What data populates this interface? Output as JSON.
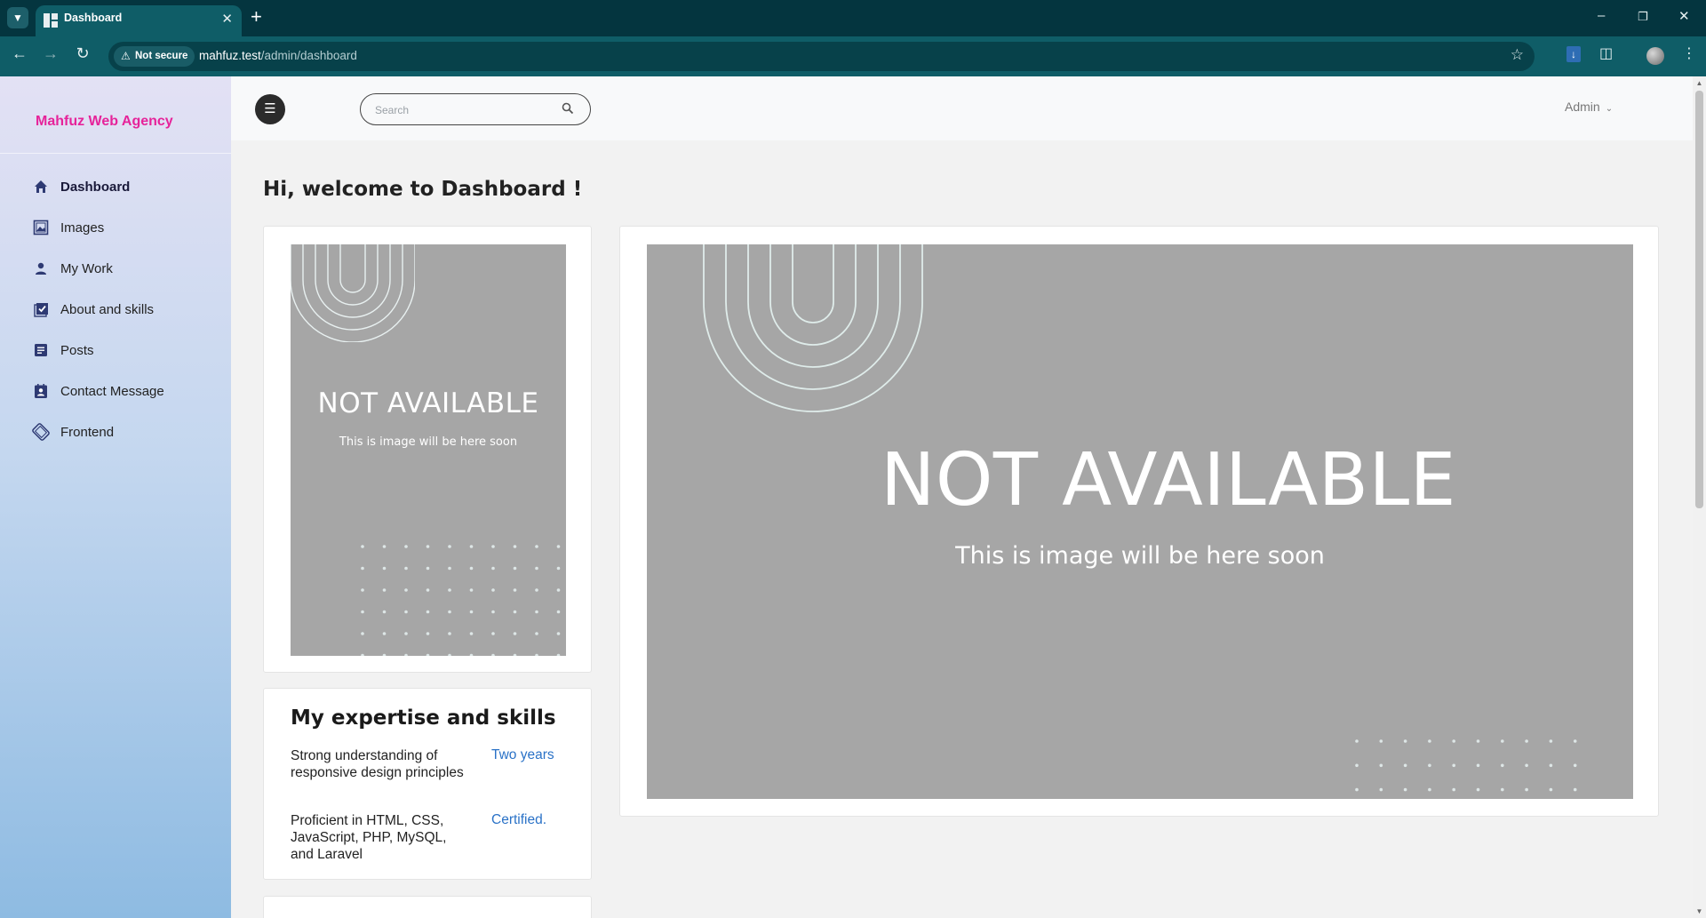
{
  "browser": {
    "tab_title": "Dashboard",
    "new_tab": "+",
    "security_label": "Not secure",
    "url_host": "mahfuz.test",
    "url_path": "/admin/dashboard"
  },
  "sidebar": {
    "brand": "Mahfuz Web Agency",
    "items": [
      {
        "label": "Dashboard",
        "icon": "home-icon",
        "active": true
      },
      {
        "label": "Images",
        "icon": "images-icon"
      },
      {
        "label": "My Work",
        "icon": "user-icon"
      },
      {
        "label": "About and skills",
        "icon": "checkbox-icon"
      },
      {
        "label": "Posts",
        "icon": "posts-icon"
      },
      {
        "label": "Contact Message",
        "icon": "contact-icon"
      },
      {
        "label": "Frontend",
        "icon": "frontend-icon"
      }
    ]
  },
  "header": {
    "search_placeholder": "Search",
    "user_menu": "Admin"
  },
  "main": {
    "welcome": "Hi, welcome to Dashboard !",
    "image_card_small": {
      "title": "NOT AVAILABLE",
      "subtitle": "This is image will be here soon"
    },
    "image_card_large": {
      "title": "NOT AVAILABLE",
      "subtitle": "This is image will be here soon"
    },
    "skills": {
      "title": "My expertise and skills",
      "rows": [
        {
          "text": "Strong understanding of responsive design principles",
          "meta": "Two years"
        },
        {
          "text": "Proficient in HTML, CSS, JavaScript, PHP, MySQL, and Laravel",
          "meta": "Certified."
        }
      ]
    }
  },
  "colors": {
    "brand": "#e6239a",
    "accent_link": "#2a72c7",
    "browser_frame": "#0f5d67",
    "placeholder_bg": "#a6a6a6"
  }
}
